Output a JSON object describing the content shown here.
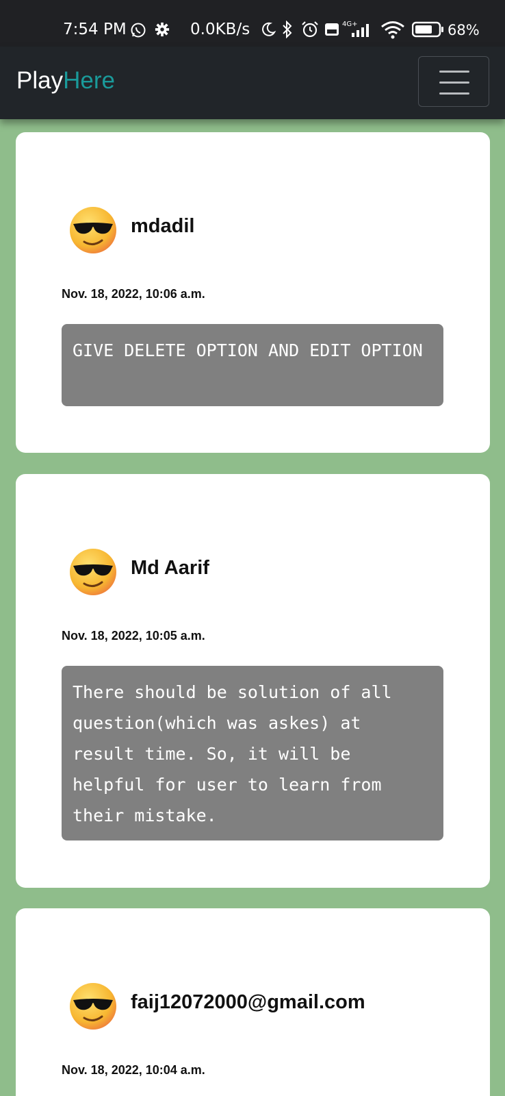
{
  "status_bar": {
    "time": "7:54 PM",
    "network_speed": "0.0KB/s",
    "battery_percent": "68%",
    "icons": [
      "whatsapp-icon",
      "gear-icon",
      "moon-icon",
      "bluetooth-icon",
      "alarm-icon",
      "volte-icon",
      "signal-4g-icon",
      "wifi-icon",
      "battery-icon"
    ]
  },
  "navbar": {
    "brand_part1": "Play",
    "brand_part2": "Here",
    "brand_accent_color": "#1a9a9a",
    "menu_icon": "hamburger-menu-icon"
  },
  "feedback": [
    {
      "username": "mdadil",
      "date": "Nov. 18, 2022, 10:06 a.m.",
      "comment": "GIVE DELETE OPTION AND EDIT OPTION",
      "avatar_icon": "sunglasses-emoji-icon"
    },
    {
      "username": "Md Aarif",
      "date": "Nov. 18, 2022, 10:05 a.m.",
      "comment": "There should be solution of all question(which was askes) at result time. So, it will be helpful for user to learn from their mistake.",
      "avatar_icon": "sunglasses-emoji-icon"
    },
    {
      "username": "faij12072000@gmail.com",
      "date": "Nov. 18, 2022, 10:04 a.m.",
      "avatar_icon": "sunglasses-emoji-icon"
    }
  ],
  "colors": {
    "page_background": "#8fbd8b",
    "navbar_background": "#212529",
    "comment_background": "#808080"
  }
}
